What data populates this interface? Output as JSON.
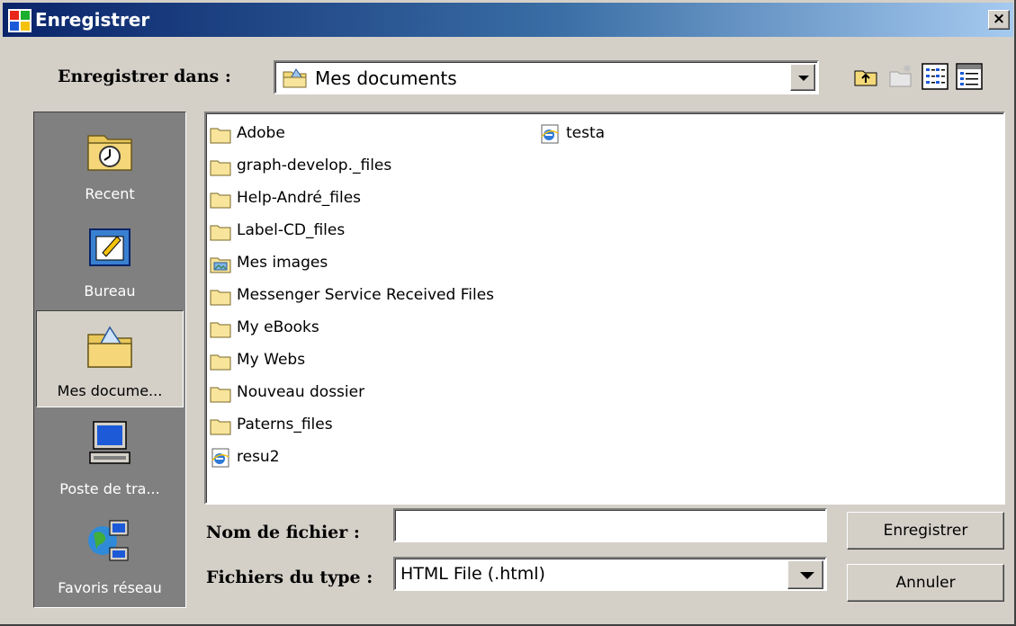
{
  "window": {
    "title": "Enregistrer",
    "close_label": "×"
  },
  "save_in": {
    "label": "Enregistrer dans :",
    "value": "Mes documents"
  },
  "toolbar": {
    "icons": [
      "up-folder-icon",
      "new-folder-icon",
      "list-view-icon",
      "details-view-icon"
    ]
  },
  "places": [
    {
      "label": "Recent",
      "icon": "recent-icon"
    },
    {
      "label": "Bureau",
      "icon": "desktop-icon"
    },
    {
      "label": "Mes docume...",
      "icon": "my-documents-icon",
      "selected": true
    },
    {
      "label": "Poste de tra...",
      "icon": "my-computer-icon"
    },
    {
      "label": "Favoris réseau",
      "icon": "network-places-icon"
    }
  ],
  "files": [
    {
      "name": "Adobe",
      "type": "folder"
    },
    {
      "name": "graph-develop._files",
      "type": "folder"
    },
    {
      "name": "Help-André_files",
      "type": "folder"
    },
    {
      "name": "Label-CD_files",
      "type": "folder"
    },
    {
      "name": "Mes images",
      "type": "pictures-folder"
    },
    {
      "name": "Messenger Service Received Files",
      "type": "folder"
    },
    {
      "name": "My eBooks",
      "type": "folder"
    },
    {
      "name": "My Webs",
      "type": "folder"
    },
    {
      "name": "Nouveau dossier",
      "type": "folder"
    },
    {
      "name": "Paterns_files",
      "type": "folder"
    },
    {
      "name": "resu2",
      "type": "html"
    },
    {
      "name": "testa",
      "type": "html"
    }
  ],
  "filename": {
    "label": "Nom de fichier :",
    "value": ""
  },
  "filetype": {
    "label": "Fichiers du type :",
    "value": "HTML File (.html)"
  },
  "buttons": {
    "save": "Enregistrer",
    "cancel": "Annuler"
  },
  "colors": {
    "titlebar_start": "#0a246a",
    "titlebar_end": "#a6caf0",
    "face": "#d4d0c8",
    "places_bg": "#808080"
  }
}
